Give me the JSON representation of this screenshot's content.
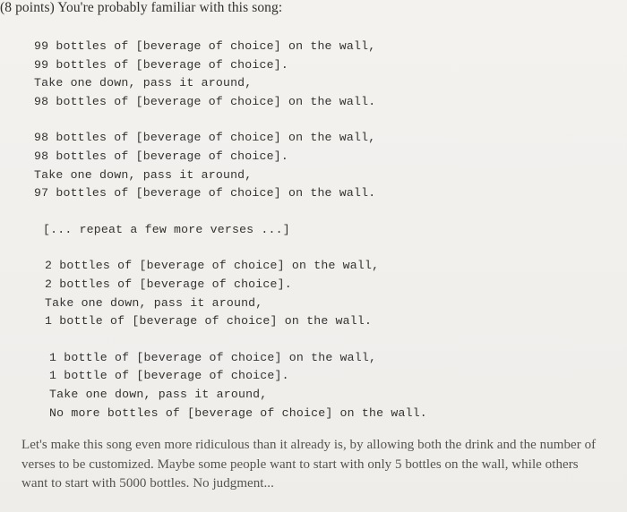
{
  "heading": "(8 points) You're probably familiar with this song:",
  "song": {
    "verses": [
      {
        "indent": "indent-1",
        "lines": [
          "99 bottles of [beverage of choice] on the wall,",
          "99 bottles of [beverage of choice].",
          "Take one down, pass it around,",
          "98 bottles of [beverage of choice] on the wall."
        ]
      },
      {
        "indent": "indent-1",
        "lines": [
          "98 bottles of [beverage of choice] on the wall,",
          "98 bottles of [beverage of choice].",
          "Take one down, pass it around,",
          "97 bottles of [beverage of choice] on the wall."
        ]
      }
    ],
    "repeat_line": "[... repeat a few more verses ...]",
    "verses_after": [
      {
        "indent": "indent-2",
        "lines": [
          "2 bottles of [beverage of choice] on the wall,",
          "2 bottles of [beverage of choice].",
          "Take one down, pass it around,",
          "1 bottle of [beverage of choice] on the wall."
        ]
      },
      {
        "indent": "indent-3",
        "lines": [
          "1 bottle of [beverage of choice] on the wall,",
          "1 bottle of [beverage of choice].",
          "Take one down, pass it around,",
          "No more bottles of [beverage of choice] on the wall."
        ]
      }
    ]
  },
  "footer": {
    "paragraph": "Let's make this song even more ridiculous than it already is, by allowing both the drink and the number of verses to be customized. Maybe some people want to start with only 5 bottles on the wall, while others want to start with 5000 bottles. No judgment..."
  }
}
